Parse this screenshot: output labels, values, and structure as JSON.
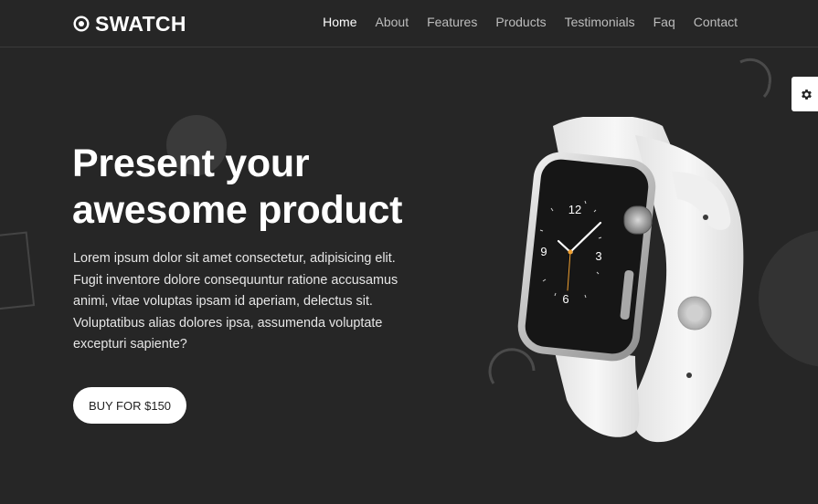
{
  "brand": {
    "name": "SWATCH",
    "icon": "target-icon"
  },
  "nav": {
    "items": [
      {
        "label": "Home",
        "active": true
      },
      {
        "label": "About",
        "active": false
      },
      {
        "label": "Features",
        "active": false
      },
      {
        "label": "Products",
        "active": false
      },
      {
        "label": "Testimonials",
        "active": false
      },
      {
        "label": "Faq",
        "active": false
      },
      {
        "label": "Contact",
        "active": false
      }
    ]
  },
  "hero": {
    "title_line1": "Present your",
    "title_line2": "awesome product",
    "description": "Lorem ipsum dolor sit amet consectetur, adipisicing elit. Fugit inventore dolore consequuntur ratione accusamus animi, vitae voluptas ipsam id aperiam, delectus sit. Voluptatibus alias dolores ipsa, assumenda voluptate excepturi sapiente?",
    "cta_label": "BUY FOR $150"
  },
  "watch": {
    "dial_numbers": [
      "12",
      "3",
      "6",
      "9"
    ]
  },
  "settings": {
    "icon": "gear-icon"
  },
  "colors": {
    "background": "#262626",
    "text": "#ffffff",
    "nav_inactive": "#bdbdbd",
    "button_bg": "#ffffff"
  }
}
